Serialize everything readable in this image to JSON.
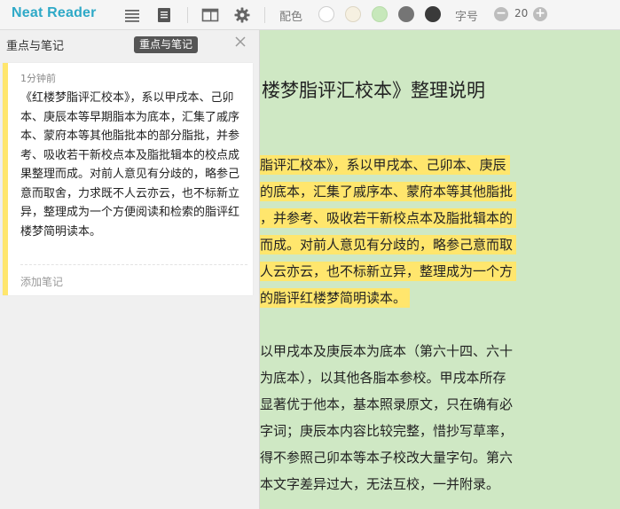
{
  "app": {
    "title": "Neat Reader"
  },
  "toolbar": {
    "color_label": "配色",
    "font_label": "字号",
    "font_size": "20",
    "minus": "−",
    "plus": "+"
  },
  "swatches": [
    {
      "name": "white",
      "color": "#ffffff"
    },
    {
      "name": "beige",
      "color": "#f6f0e1"
    },
    {
      "name": "green",
      "color": "#c7e8bb"
    },
    {
      "name": "gray",
      "color": "#757575"
    },
    {
      "name": "black",
      "color": "#3a3a3a"
    }
  ],
  "notes_panel": {
    "title": "重点与笔记",
    "tooltip": "重点与笔记",
    "card": {
      "time": "1分钟前",
      "quote": "《红楼梦脂评汇校本》，系以甲戌本、己卯本、庚辰本等早期脂本为底本，汇集了戚序本、蒙府本等其他脂批本的部分脂批，并参考、吸收若干新校点本及脂批辑本的校点成果整理而成。对前人意见有分歧的，略参己意而取舍，力求既不人云亦云，也不标新立异，整理成为一个方便阅读和检索的脂评红楼梦简明读本。",
      "add_note": "添加笔记"
    }
  },
  "reader": {
    "chapter_title": "楼梦脂评汇校本》整理说明",
    "highlighted_lines": [
      "脂评汇校本》，系以甲戌本、己卯本、庚辰",
      "的底本，汇集了戚序本、蒙府本等其他脂批",
      "，并参考、吸收若干新校点本及脂批辑本的",
      "而成。对前人意见有分歧的，略参己意而取",
      "人云亦云，也不标新立异，整理成为一个方",
      "的脂评红楼梦简明读本。"
    ],
    "lines": [
      "以甲戌本及庚辰本为底本（第六十四、六十",
      "为底本），以其他各脂本参校。甲戌本所存",
      "显著优于他本，基本照录原文，只在确有必",
      "字词；庚辰本内容比较完整，惜抄写草率，",
      "得不参照己卯本等本子校改大量字句。第六",
      "本文字差异过大，无法互校，一并附录。"
    ]
  }
}
